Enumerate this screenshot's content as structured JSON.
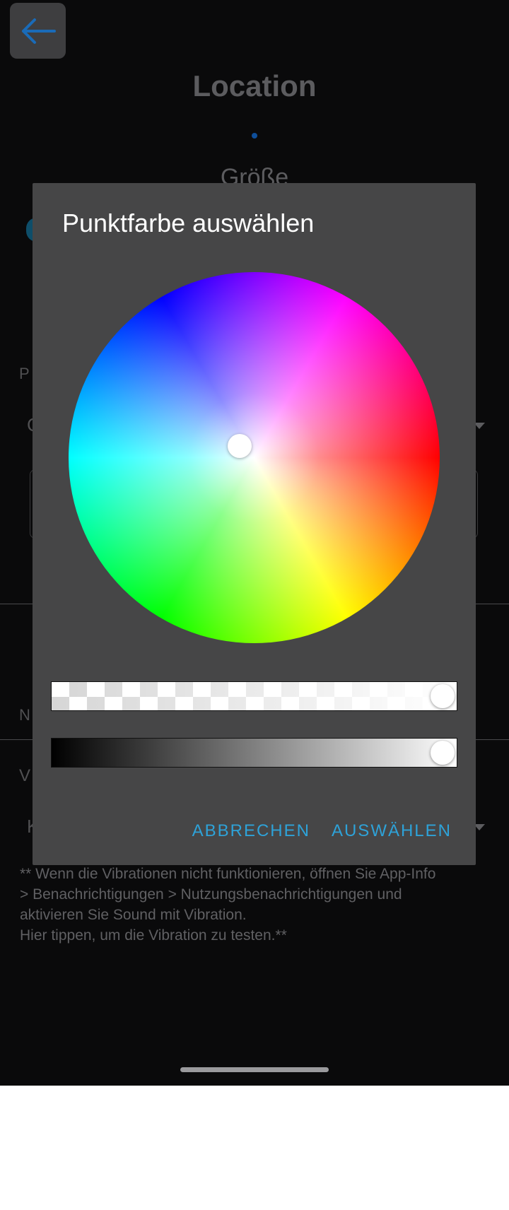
{
  "background": {
    "title": "Location",
    "size_label": "Größe",
    "section_label_1": "P",
    "field_value_1": "C",
    "section_label_2": "N",
    "section_label_3": "V",
    "field_value_2": "K",
    "note_lines": [
      "** Wenn die Vibrationen nicht funktionieren, öffnen Sie App-Info",
      "> Benachrichtigungen > Nutzungsbenachrichtigungen und",
      "aktivieren Sie Sound mit Vibration.",
      "Hier tippen, um die Vibration zu testen.**"
    ]
  },
  "dialog": {
    "title": "Punktfarbe auswählen",
    "cancel_label": "ABBRECHEN",
    "select_label": "AUSWÄHLEN",
    "alpha_level": 1.0,
    "brightness_level": 1.0
  },
  "colors": {
    "accent": "#2ea2d8",
    "dialog_bg": "#464647",
    "screen_bg": "#0a0a0b"
  },
  "icons": {
    "back": "arrow-left-icon"
  }
}
